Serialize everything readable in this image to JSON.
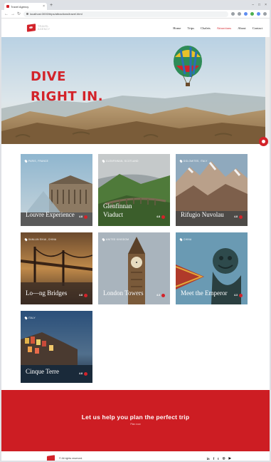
{
  "browser": {
    "tab_title": "Travel Agency",
    "tab_close": "×",
    "new_tab": "+",
    "url": "localhost:3000/trips/attractions/travel.html",
    "win_min": "–",
    "win_max": "□",
    "win_close": "×",
    "back": "←",
    "forward": "→",
    "reload": "↻"
  },
  "header": {
    "logo_line1": "TRAVEL",
    "logo_line2": "AGENCY",
    "nav": [
      "Home",
      "Trips",
      "Chalets",
      "Attractions",
      "About",
      "Contact"
    ],
    "active_nav": "Attractions"
  },
  "hero": {
    "line1": "DIVE",
    "line2": "RIGHT IN."
  },
  "cards": [
    {
      "location": "Paris, France",
      "title": "Louvre Experience",
      "rating": "4.8"
    },
    {
      "location": "Glenfinnan, Scotland",
      "title": "Glenfinnan Viaduct",
      "rating": "4.8"
    },
    {
      "location": "Dolomites, Italy",
      "title": "Rifugio Nuvolau",
      "rating": "4.8"
    },
    {
      "location": "Sanlun Eikai, China",
      "title": "Lo—ng Bridges",
      "rating": "4.8"
    },
    {
      "location": "United Kingdom",
      "title": "London Towers",
      "rating": "4.3"
    },
    {
      "location": "China",
      "title": "Meet the Emperor",
      "rating": "4.3"
    },
    {
      "location": "Italy",
      "title": "Cinque Terre",
      "rating": "4.8"
    }
  ],
  "cta": {
    "title": "Let us help you plan the perfect trip",
    "link": "Plan now"
  },
  "footer": {
    "copyright": "© All rights reserved.",
    "social": [
      "in",
      "f",
      "t",
      "◎",
      "▶"
    ]
  },
  "colors": {
    "accent": "#d3232a",
    "cta_bg": "#cd1d23"
  }
}
